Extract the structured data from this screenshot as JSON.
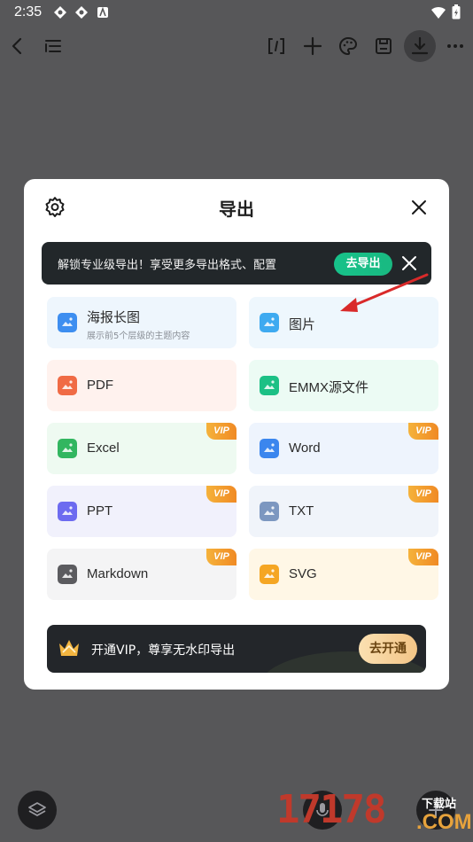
{
  "status": {
    "time": "2:35"
  },
  "modal": {
    "title": "导出",
    "promo": {
      "text": "解锁专业级导出！享受更多导出格式、配置",
      "button": "去导出"
    },
    "options": [
      {
        "label": "海报长图",
        "sub": "展示前5个层级的主题内容",
        "vip": false,
        "bg": "#eef6fd",
        "icon": "poster-image-icon",
        "color": "#3d8ef0"
      },
      {
        "label": "图片",
        "sub": "",
        "vip": false,
        "bg": "#eef7fd",
        "icon": "image-icon",
        "color": "#3eaaf0"
      },
      {
        "label": "PDF",
        "sub": "",
        "vip": false,
        "bg": "#fff2ee",
        "icon": "pdf-icon",
        "color": "#f06b45"
      },
      {
        "label": "EMMX源文件",
        "sub": "",
        "vip": false,
        "bg": "#ecfbf4",
        "icon": "emmx-icon",
        "color": "#1cc085"
      },
      {
        "label": "Excel",
        "sub": "",
        "vip": true,
        "bg": "#eefaf1",
        "icon": "excel-icon",
        "color": "#32b660"
      },
      {
        "label": "Word",
        "sub": "",
        "vip": true,
        "bg": "#eef4fd",
        "icon": "word-icon",
        "color": "#3b86ee"
      },
      {
        "label": "PPT",
        "sub": "",
        "vip": true,
        "bg": "#f1f1fc",
        "icon": "ppt-icon",
        "color": "#6d6bf0"
      },
      {
        "label": "TXT",
        "sub": "",
        "vip": true,
        "bg": "#f0f4fa",
        "icon": "txt-icon",
        "color": "#7c97c0"
      },
      {
        "label": "Markdown",
        "sub": "",
        "vip": true,
        "bg": "#f4f4f5",
        "icon": "markdown-icon",
        "color": "#5b5b5f"
      },
      {
        "label": "SVG",
        "sub": "",
        "vip": true,
        "bg": "#fff7e6",
        "icon": "svg-icon",
        "color": "#f5a623"
      }
    ],
    "vip_badge": "VIP",
    "vip_bar": {
      "text": "开通VIP，尊享无水印导出",
      "button": "去开通"
    }
  },
  "watermark": {
    "main": "17178",
    "sub": "下载站",
    "com": ".COM"
  },
  "colors": {
    "accent": "#17c28a",
    "vip": "#f08a24",
    "backdrop": "#575759"
  }
}
